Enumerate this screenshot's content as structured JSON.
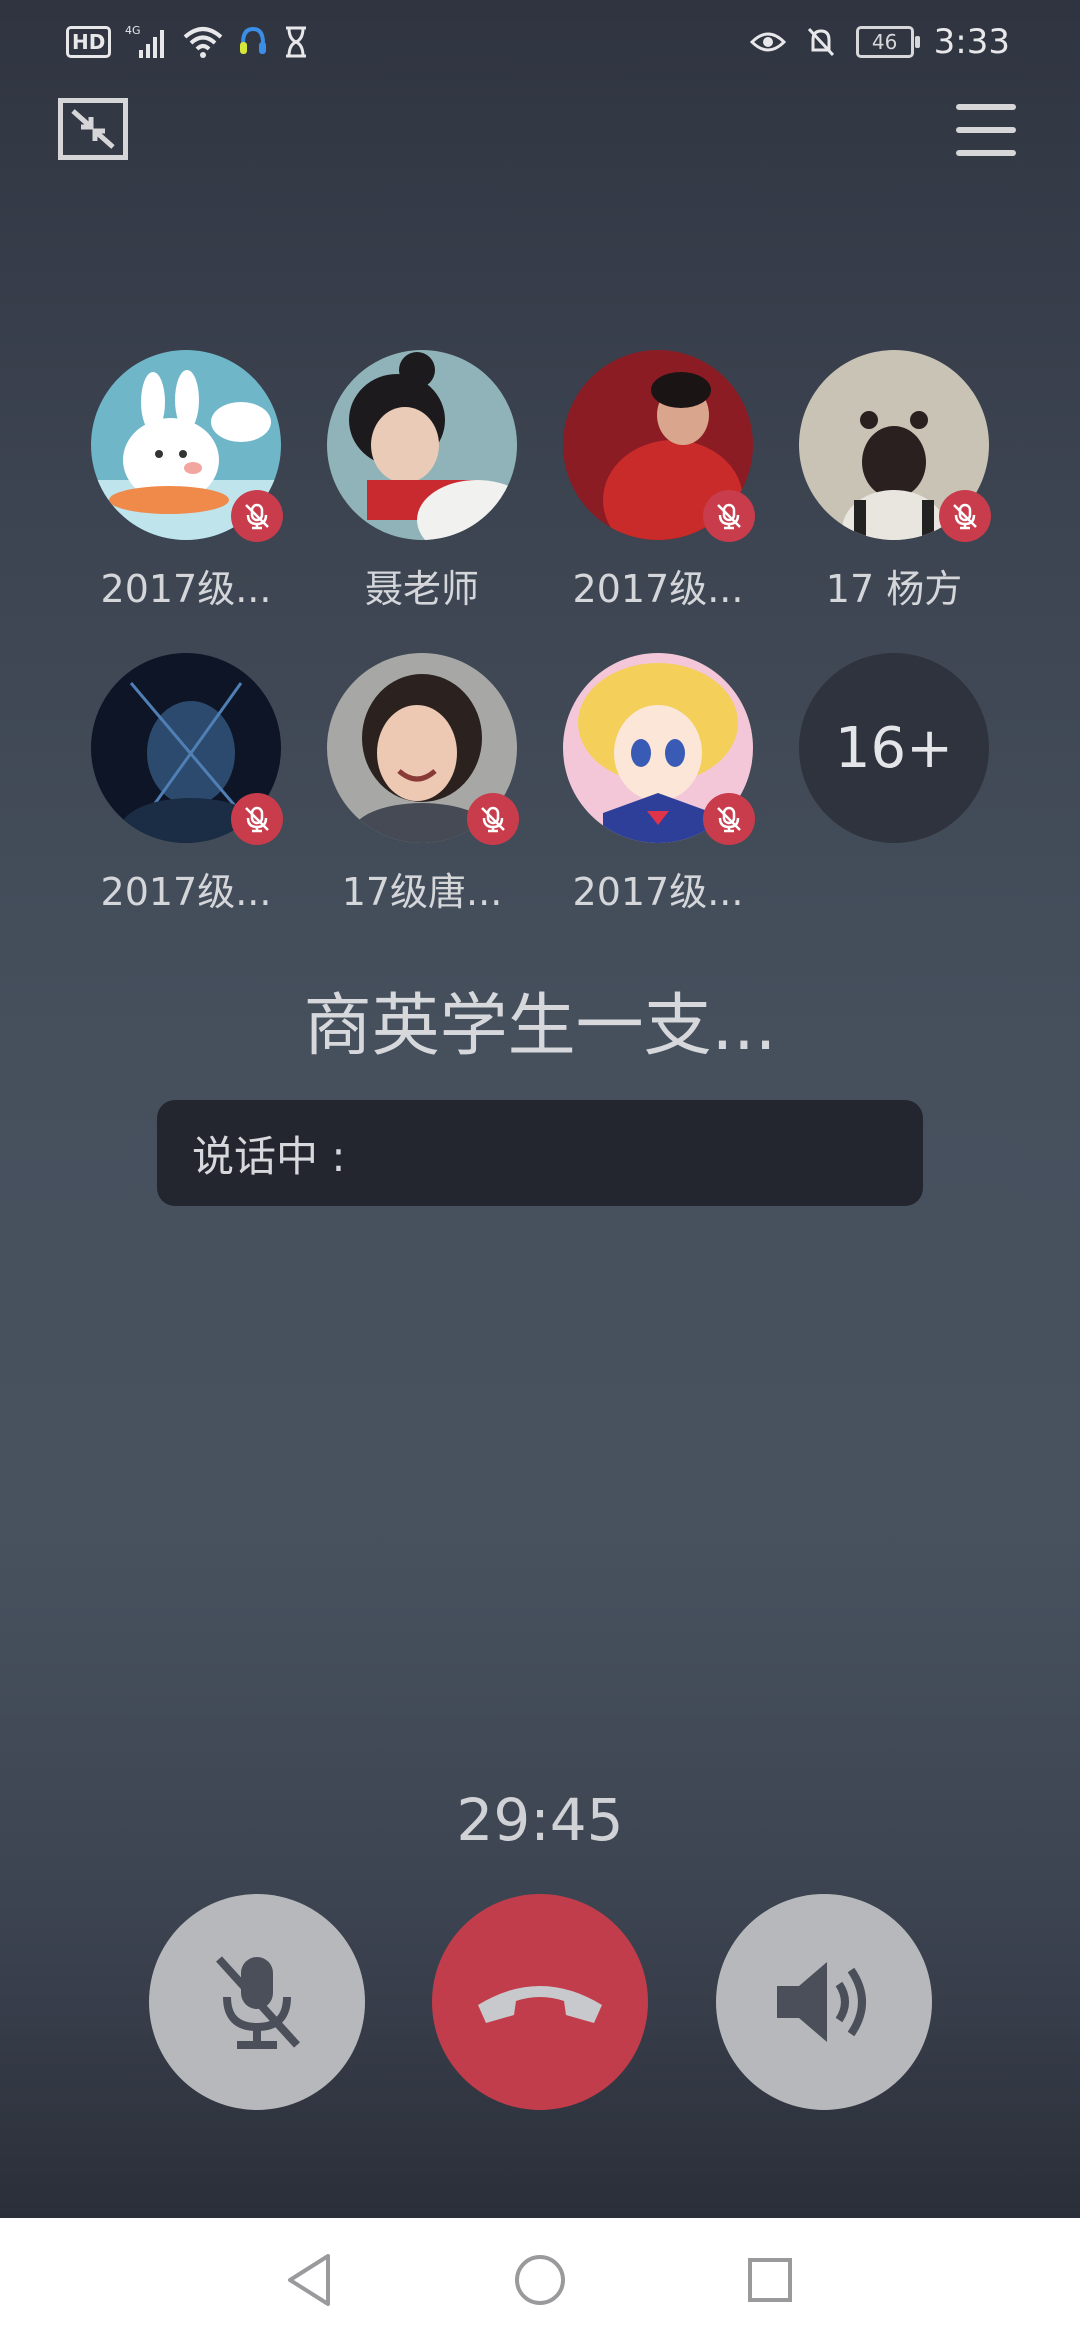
{
  "status_bar": {
    "time": "3:33",
    "battery": "46",
    "left_icons": [
      "hd-icon",
      "4g-signal-icon",
      "wifi-icon",
      "headset-app-icon",
      "hourglass-icon"
    ],
    "right_icons": [
      "eye-icon",
      "bell-off-icon",
      "battery-icon"
    ]
  },
  "participants": [
    {
      "name": "2017级...",
      "muted": true,
      "avatar": "bunny-avatar"
    },
    {
      "name": "聂老师",
      "muted": false,
      "avatar": "girl-red-scarf-avatar"
    },
    {
      "name": "2017级...",
      "muted": true,
      "avatar": "red-jacket-avatar"
    },
    {
      "name": "17 杨方",
      "muted": true,
      "avatar": "child-back-avatar"
    },
    {
      "name": "2017级...",
      "muted": true,
      "avatar": "dark-portrait-avatar"
    },
    {
      "name": "17级唐...",
      "muted": true,
      "avatar": "smiling-woman-avatar"
    },
    {
      "name": "2017级...",
      "muted": true,
      "avatar": "sailor-moon-avatar"
    }
  ],
  "more_count": "16+",
  "group_title": "商英学生一支...",
  "speaking_label": "说话中 :",
  "timer": "29:45",
  "colors": {
    "hangup": "#c13d4b",
    "mute_badge": "#c93c4c",
    "control_grey": "#b7b8bb"
  }
}
